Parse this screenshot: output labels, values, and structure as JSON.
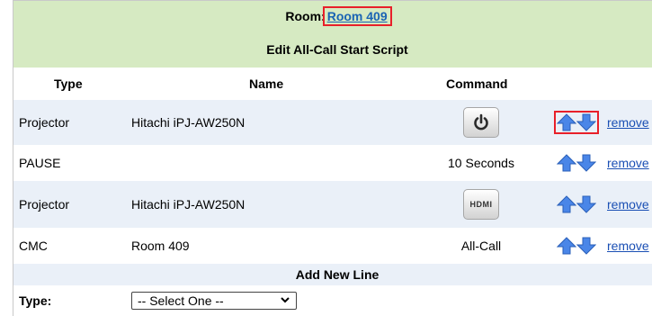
{
  "header": {
    "room_prefix": "Room:",
    "room_link": "Room 409",
    "title": "Edit All-Call Start Script"
  },
  "columns": {
    "type": "Type",
    "name": "Name",
    "command": "Command"
  },
  "rows": [
    {
      "type": "Projector",
      "name": "Hitachi iPJ-AW250N",
      "command": "",
      "command_icon": "power-icon",
      "remove": "remove"
    },
    {
      "type": "PAUSE",
      "name": "",
      "command": "10 Seconds",
      "remove": "remove"
    },
    {
      "type": "Projector",
      "name": "Hitachi iPJ-AW250N",
      "command": "HDMI",
      "command_icon": "hdmi-icon",
      "remove": "remove"
    },
    {
      "type": "CMC",
      "name": "Room 409",
      "command": "All-Call",
      "remove": "remove"
    }
  ],
  "add_section": {
    "title": "Add New Line",
    "type_label": "Type:",
    "type_select_value": "-- Select One --"
  },
  "colors": {
    "header_bg": "#d6eac2",
    "alt_row_bg": "#eaf0f8",
    "link": "#1a64b4",
    "highlight": "#e8202a",
    "arrow": "#4a86e8"
  }
}
